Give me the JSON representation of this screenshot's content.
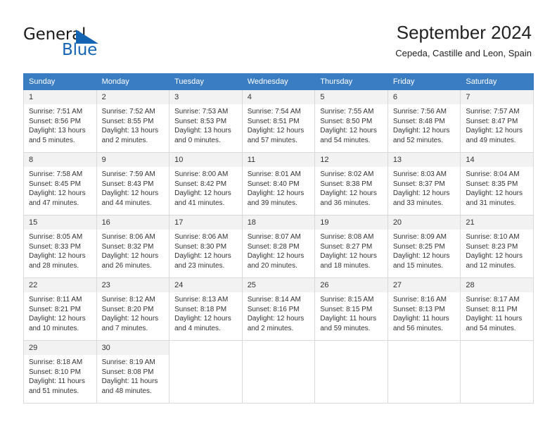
{
  "brand": {
    "word_one": "General",
    "word_two": "Blue",
    "triangle_icon": "triangle-icon",
    "accent_color": "#1464b4"
  },
  "header": {
    "title": "September 2024",
    "subtitle": "Cepeda, Castille and Leon, Spain"
  },
  "calendar": {
    "header_background": "#3b7dc2",
    "daynum_background": "#f2f2f2",
    "weekdays": [
      "Sunday",
      "Monday",
      "Tuesday",
      "Wednesday",
      "Thursday",
      "Friday",
      "Saturday"
    ],
    "weeks": [
      [
        {
          "day": "1",
          "sunrise": "Sunrise: 7:51 AM",
          "sunset": "Sunset: 8:56 PM",
          "daylight_1": "Daylight: 13 hours",
          "daylight_2": "and 5 minutes."
        },
        {
          "day": "2",
          "sunrise": "Sunrise: 7:52 AM",
          "sunset": "Sunset: 8:55 PM",
          "daylight_1": "Daylight: 13 hours",
          "daylight_2": "and 2 minutes."
        },
        {
          "day": "3",
          "sunrise": "Sunrise: 7:53 AM",
          "sunset": "Sunset: 8:53 PM",
          "daylight_1": "Daylight: 13 hours",
          "daylight_2": "and 0 minutes."
        },
        {
          "day": "4",
          "sunrise": "Sunrise: 7:54 AM",
          "sunset": "Sunset: 8:51 PM",
          "daylight_1": "Daylight: 12 hours",
          "daylight_2": "and 57 minutes."
        },
        {
          "day": "5",
          "sunrise": "Sunrise: 7:55 AM",
          "sunset": "Sunset: 8:50 PM",
          "daylight_1": "Daylight: 12 hours",
          "daylight_2": "and 54 minutes."
        },
        {
          "day": "6",
          "sunrise": "Sunrise: 7:56 AM",
          "sunset": "Sunset: 8:48 PM",
          "daylight_1": "Daylight: 12 hours",
          "daylight_2": "and 52 minutes."
        },
        {
          "day": "7",
          "sunrise": "Sunrise: 7:57 AM",
          "sunset": "Sunset: 8:47 PM",
          "daylight_1": "Daylight: 12 hours",
          "daylight_2": "and 49 minutes."
        }
      ],
      [
        {
          "day": "8",
          "sunrise": "Sunrise: 7:58 AM",
          "sunset": "Sunset: 8:45 PM",
          "daylight_1": "Daylight: 12 hours",
          "daylight_2": "and 47 minutes."
        },
        {
          "day": "9",
          "sunrise": "Sunrise: 7:59 AM",
          "sunset": "Sunset: 8:43 PM",
          "daylight_1": "Daylight: 12 hours",
          "daylight_2": "and 44 minutes."
        },
        {
          "day": "10",
          "sunrise": "Sunrise: 8:00 AM",
          "sunset": "Sunset: 8:42 PM",
          "daylight_1": "Daylight: 12 hours",
          "daylight_2": "and 41 minutes."
        },
        {
          "day": "11",
          "sunrise": "Sunrise: 8:01 AM",
          "sunset": "Sunset: 8:40 PM",
          "daylight_1": "Daylight: 12 hours",
          "daylight_2": "and 39 minutes."
        },
        {
          "day": "12",
          "sunrise": "Sunrise: 8:02 AM",
          "sunset": "Sunset: 8:38 PM",
          "daylight_1": "Daylight: 12 hours",
          "daylight_2": "and 36 minutes."
        },
        {
          "day": "13",
          "sunrise": "Sunrise: 8:03 AM",
          "sunset": "Sunset: 8:37 PM",
          "daylight_1": "Daylight: 12 hours",
          "daylight_2": "and 33 minutes."
        },
        {
          "day": "14",
          "sunrise": "Sunrise: 8:04 AM",
          "sunset": "Sunset: 8:35 PM",
          "daylight_1": "Daylight: 12 hours",
          "daylight_2": "and 31 minutes."
        }
      ],
      [
        {
          "day": "15",
          "sunrise": "Sunrise: 8:05 AM",
          "sunset": "Sunset: 8:33 PM",
          "daylight_1": "Daylight: 12 hours",
          "daylight_2": "and 28 minutes."
        },
        {
          "day": "16",
          "sunrise": "Sunrise: 8:06 AM",
          "sunset": "Sunset: 8:32 PM",
          "daylight_1": "Daylight: 12 hours",
          "daylight_2": "and 26 minutes."
        },
        {
          "day": "17",
          "sunrise": "Sunrise: 8:06 AM",
          "sunset": "Sunset: 8:30 PM",
          "daylight_1": "Daylight: 12 hours",
          "daylight_2": "and 23 minutes."
        },
        {
          "day": "18",
          "sunrise": "Sunrise: 8:07 AM",
          "sunset": "Sunset: 8:28 PM",
          "daylight_1": "Daylight: 12 hours",
          "daylight_2": "and 20 minutes."
        },
        {
          "day": "19",
          "sunrise": "Sunrise: 8:08 AM",
          "sunset": "Sunset: 8:27 PM",
          "daylight_1": "Daylight: 12 hours",
          "daylight_2": "and 18 minutes."
        },
        {
          "day": "20",
          "sunrise": "Sunrise: 8:09 AM",
          "sunset": "Sunset: 8:25 PM",
          "daylight_1": "Daylight: 12 hours",
          "daylight_2": "and 15 minutes."
        },
        {
          "day": "21",
          "sunrise": "Sunrise: 8:10 AM",
          "sunset": "Sunset: 8:23 PM",
          "daylight_1": "Daylight: 12 hours",
          "daylight_2": "and 12 minutes."
        }
      ],
      [
        {
          "day": "22",
          "sunrise": "Sunrise: 8:11 AM",
          "sunset": "Sunset: 8:21 PM",
          "daylight_1": "Daylight: 12 hours",
          "daylight_2": "and 10 minutes."
        },
        {
          "day": "23",
          "sunrise": "Sunrise: 8:12 AM",
          "sunset": "Sunset: 8:20 PM",
          "daylight_1": "Daylight: 12 hours",
          "daylight_2": "and 7 minutes."
        },
        {
          "day": "24",
          "sunrise": "Sunrise: 8:13 AM",
          "sunset": "Sunset: 8:18 PM",
          "daylight_1": "Daylight: 12 hours",
          "daylight_2": "and 4 minutes."
        },
        {
          "day": "25",
          "sunrise": "Sunrise: 8:14 AM",
          "sunset": "Sunset: 8:16 PM",
          "daylight_1": "Daylight: 12 hours",
          "daylight_2": "and 2 minutes."
        },
        {
          "day": "26",
          "sunrise": "Sunrise: 8:15 AM",
          "sunset": "Sunset: 8:15 PM",
          "daylight_1": "Daylight: 11 hours",
          "daylight_2": "and 59 minutes."
        },
        {
          "day": "27",
          "sunrise": "Sunrise: 8:16 AM",
          "sunset": "Sunset: 8:13 PM",
          "daylight_1": "Daylight: 11 hours",
          "daylight_2": "and 56 minutes."
        },
        {
          "day": "28",
          "sunrise": "Sunrise: 8:17 AM",
          "sunset": "Sunset: 8:11 PM",
          "daylight_1": "Daylight: 11 hours",
          "daylight_2": "and 54 minutes."
        }
      ],
      [
        {
          "day": "29",
          "sunrise": "Sunrise: 8:18 AM",
          "sunset": "Sunset: 8:10 PM",
          "daylight_1": "Daylight: 11 hours",
          "daylight_2": "and 51 minutes."
        },
        {
          "day": "30",
          "sunrise": "Sunrise: 8:19 AM",
          "sunset": "Sunset: 8:08 PM",
          "daylight_1": "Daylight: 11 hours",
          "daylight_2": "and 48 minutes."
        },
        {
          "day": "",
          "sunrise": "",
          "sunset": "",
          "daylight_1": "",
          "daylight_2": ""
        },
        {
          "day": "",
          "sunrise": "",
          "sunset": "",
          "daylight_1": "",
          "daylight_2": ""
        },
        {
          "day": "",
          "sunrise": "",
          "sunset": "",
          "daylight_1": "",
          "daylight_2": ""
        },
        {
          "day": "",
          "sunrise": "",
          "sunset": "",
          "daylight_1": "",
          "daylight_2": ""
        },
        {
          "day": "",
          "sunrise": "",
          "sunset": "",
          "daylight_1": "",
          "daylight_2": ""
        }
      ]
    ]
  }
}
